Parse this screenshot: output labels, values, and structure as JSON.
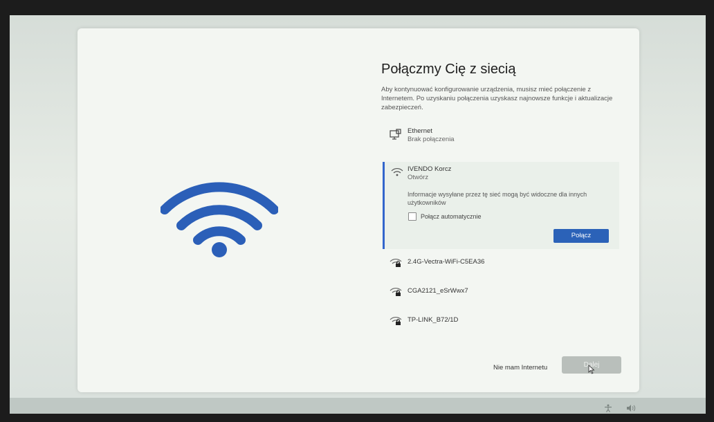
{
  "title": "Połączmy Cię z siecią",
  "description": "Aby kontynuować konfigurowanie urządzenia, musisz mieć połączenie z Internetem. Po uzyskaniu połączenia uzyskasz najnowsze funkcje i aktualizacje zabezpieczeń.",
  "ethernet": {
    "name": "Ethernet",
    "status": "Brak połączenia",
    "icon": "ethernet-icon"
  },
  "selected_network": {
    "name": "IVENDO Korcz",
    "status": "Otwórz",
    "info": "Informacje wysyłane przez tę sieć mogą być widoczne dla innych użytkowników",
    "auto_connect_label": "Połącz automatycznie",
    "auto_connect_checked": false,
    "connect_label": "Połącz",
    "icon": "wifi-icon"
  },
  "networks": [
    {
      "name": "2.4G-Vectra-WiFi-C5EA36",
      "icon": "wifi-locked-icon"
    },
    {
      "name": "CGA2121_eSrWwx7",
      "icon": "wifi-locked-icon"
    },
    {
      "name": "TP-LINK_B72/1D",
      "icon": "wifi-locked-icon"
    }
  ],
  "footer": {
    "no_internet_label": "Nie mam Internetu",
    "next_label": "Dalej"
  },
  "colors": {
    "accent": "#2b62b8",
    "wifi_art": "#2b5fb8",
    "card_bg": "#f3f6f2"
  }
}
